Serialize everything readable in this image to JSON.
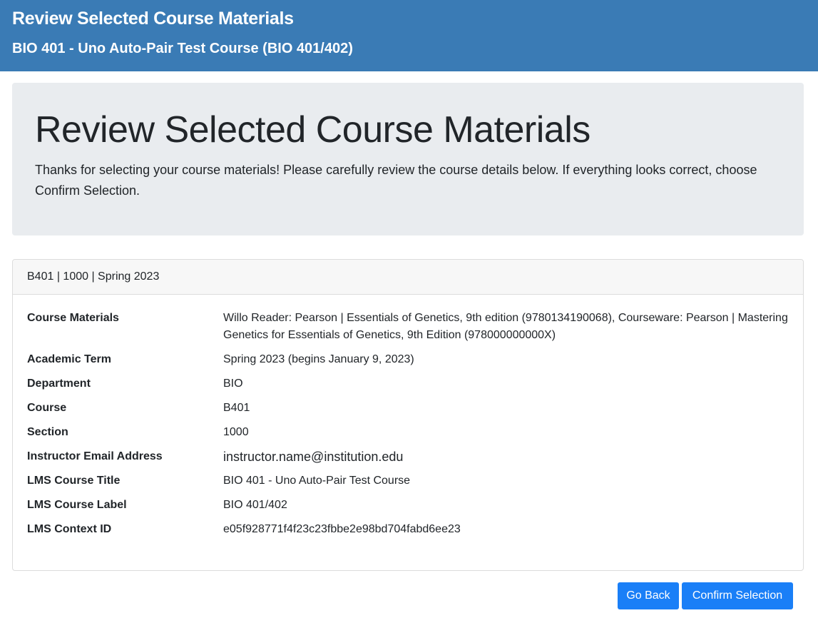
{
  "header": {
    "title": "Review Selected Course Materials",
    "subtitle": "BIO 401 - Uno Auto-Pair Test Course (BIO 401/402)"
  },
  "jumbotron": {
    "heading": "Review Selected Course Materials",
    "lead": "Thanks for selecting your course materials! Please carefully review the course details below. If everything looks correct, choose Confirm Selection."
  },
  "card": {
    "header": "B401 | 1000 | Spring 2023",
    "rows": [
      {
        "label": "Course Materials",
        "value": "Willo Reader: Pearson | Essentials of Genetics, 9th edition (9780134190068), Courseware: Pearson | Mastering Genetics for Essentials of Genetics, 9th Edition (978000000000X)"
      },
      {
        "label": "Academic Term",
        "value": "Spring 2023 (begins January 9, 2023)"
      },
      {
        "label": "Department",
        "value": "BIO"
      },
      {
        "label": "Course",
        "value": "B401"
      },
      {
        "label": "Section",
        "value": "1000"
      },
      {
        "label": "Instructor Email Address",
        "value": "instructor.name@institution.edu"
      },
      {
        "label": "LMS Course Title",
        "value": "BIO 401 - Uno Auto-Pair Test Course"
      },
      {
        "label": "LMS Course Label",
        "value": "BIO 401/402"
      },
      {
        "label": "LMS Context ID",
        "value": "e05f928771f4f23c23fbbe2e98bd704fabd6ee23"
      }
    ]
  },
  "actions": {
    "back_label": "Go Back",
    "confirm_label": "Confirm Selection"
  },
  "colors": {
    "header_bg": "#3a7bb5",
    "jumbotron_bg": "#e9ecef",
    "button_bg": "#1a7ff7"
  }
}
